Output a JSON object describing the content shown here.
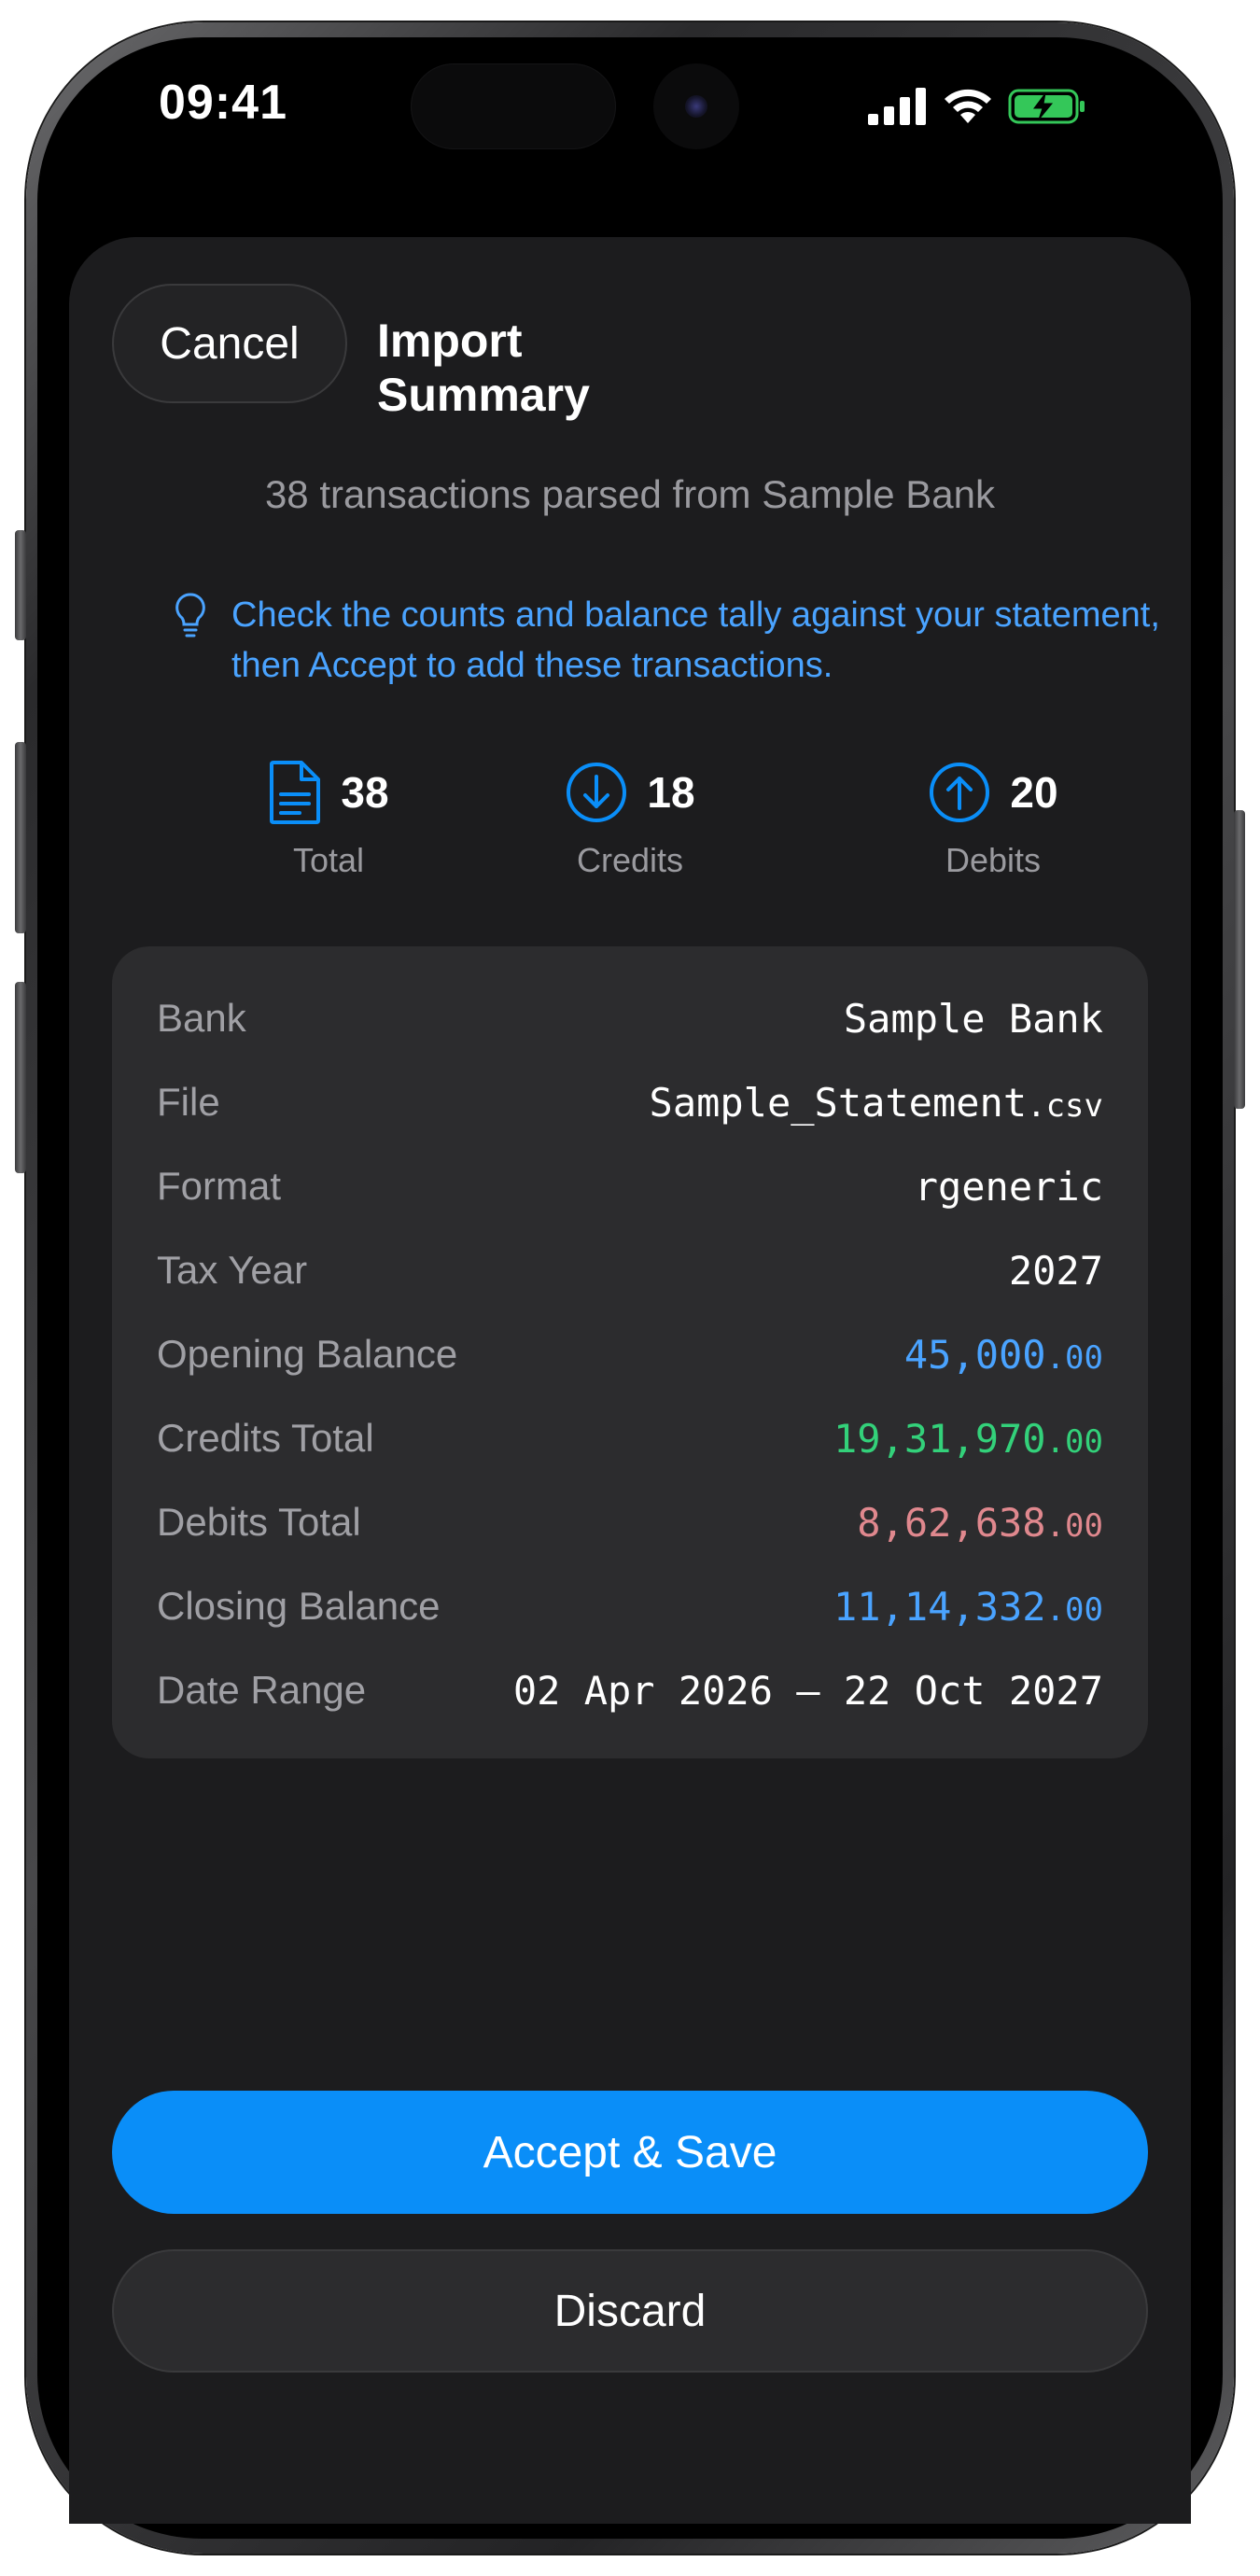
{
  "status_bar": {
    "time": "09:41",
    "icons": [
      "cellular-signal-icon",
      "wifi-icon",
      "battery-charging-icon"
    ]
  },
  "header": {
    "cancel_label": "Cancel",
    "title": "Import Summary"
  },
  "summary": {
    "parsed_text": "38 transactions parsed from Sample Bank",
    "tip": "Check the counts and balance tally against your statement, then Accept to add these transactions."
  },
  "stats": [
    {
      "icon": "document-icon",
      "value": "38",
      "label": "Total"
    },
    {
      "icon": "arrow-down-circle-icon",
      "value": "18",
      "label": "Credits"
    },
    {
      "icon": "arrow-up-circle-icon",
      "value": "20",
      "label": "Debits"
    }
  ],
  "details": {
    "bank": {
      "label": "Bank",
      "value": "Sample Bank"
    },
    "file": {
      "label": "File",
      "value_name": "Sample_Statement",
      "value_ext": ".csv"
    },
    "format": {
      "label": "Format",
      "value": "rgeneric"
    },
    "tax_year": {
      "label": "Tax Year",
      "value": "2027"
    },
    "opening_balance": {
      "label": "Opening Balance",
      "value_int": "45,000",
      "value_dec": ".00"
    },
    "credits_total": {
      "label": "Credits Total",
      "value_int": "19,31,970",
      "value_dec": ".00"
    },
    "debits_total": {
      "label": "Debits Total",
      "value_int": "8,62,638",
      "value_dec": ".00"
    },
    "closing_balance": {
      "label": "Closing Balance",
      "value_int": "11,14,332",
      "value_dec": ".00"
    },
    "date_range": {
      "label": "Date Range",
      "value": "02 Apr 2026 — 22 Oct 2027"
    }
  },
  "actions": {
    "accept_label": "Accept & Save",
    "discard_label": "Discard"
  },
  "colors": {
    "accent": "#0a8ef8",
    "credit": "#33d17a",
    "debit": "#e0888e",
    "balance": "#4aa3ff",
    "sheet_bg": "#1c1c1e",
    "card_bg": "#2c2c2e"
  }
}
